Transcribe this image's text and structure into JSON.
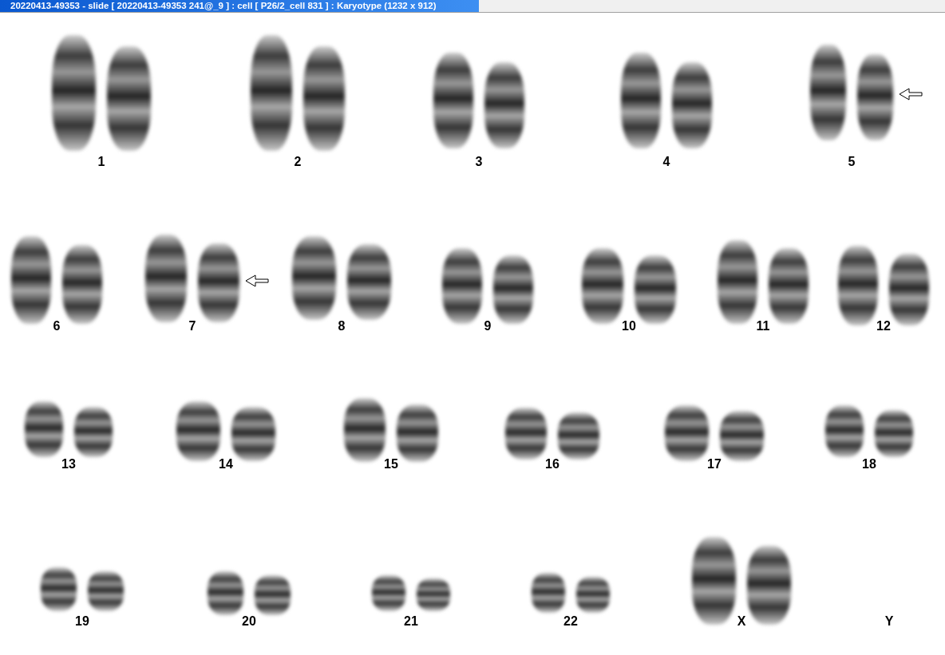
{
  "window": {
    "title": "20220413-49353 - slide [ 20220413-49353 241@_9 ] : cell [ P26/2_cell 831 ] : Karyotype  (1232 x 912)"
  },
  "chromosomes": [
    {
      "label": "1",
      "kind": "pair",
      "marked": false
    },
    {
      "label": "2",
      "kind": "pair",
      "marked": false
    },
    {
      "label": "3",
      "kind": "pair",
      "marked": false
    },
    {
      "label": "4",
      "kind": "pair",
      "marked": false
    },
    {
      "label": "5",
      "kind": "pair",
      "marked": true
    },
    {
      "label": "6",
      "kind": "pair",
      "marked": false
    },
    {
      "label": "7",
      "kind": "pair",
      "marked": true
    },
    {
      "label": "8",
      "kind": "pair",
      "marked": false
    },
    {
      "label": "9",
      "kind": "pair",
      "marked": false
    },
    {
      "label": "10",
      "kind": "pair",
      "marked": false
    },
    {
      "label": "11",
      "kind": "pair",
      "marked": false
    },
    {
      "label": "12",
      "kind": "pair",
      "marked": false
    },
    {
      "label": "13",
      "kind": "pair",
      "marked": false
    },
    {
      "label": "14",
      "kind": "pair",
      "marked": false
    },
    {
      "label": "15",
      "kind": "pair",
      "marked": false
    },
    {
      "label": "16",
      "kind": "pair",
      "marked": false
    },
    {
      "label": "17",
      "kind": "pair",
      "marked": false
    },
    {
      "label": "18",
      "kind": "pair",
      "marked": false
    },
    {
      "label": "19",
      "kind": "pair",
      "marked": false
    },
    {
      "label": "20",
      "kind": "pair",
      "marked": false
    },
    {
      "label": "21",
      "kind": "pair",
      "marked": false
    },
    {
      "label": "22",
      "kind": "pair",
      "marked": false
    },
    {
      "label": "X",
      "kind": "pair",
      "marked": false
    },
    {
      "label": "Y",
      "kind": "empty",
      "marked": false
    }
  ]
}
